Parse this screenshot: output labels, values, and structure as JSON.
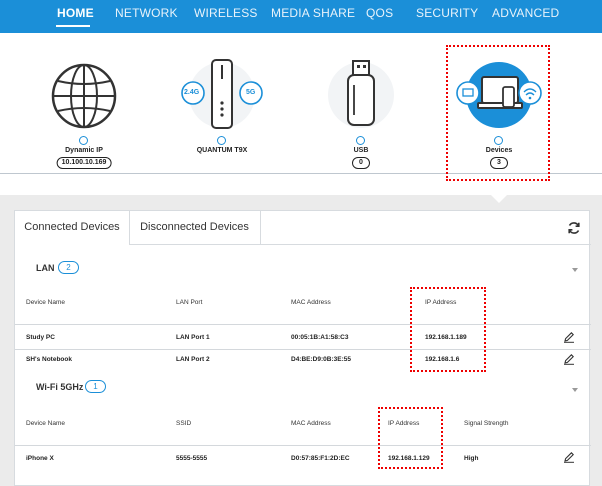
{
  "nav": {
    "items": [
      "HOME",
      "NETWORK",
      "WIRELESS",
      "MEDIA SHARE",
      "QOS",
      "SECURITY",
      "ADVANCED"
    ]
  },
  "topology": {
    "internet": {
      "label": "Dynamic IP",
      "value": "10.100.10.169"
    },
    "router": {
      "label": "QUANTUM T9X",
      "band_a": "2.4G",
      "band_b": "5G"
    },
    "usb": {
      "label": "USB",
      "value": "0"
    },
    "devices": {
      "label": "Devices",
      "value": "3"
    }
  },
  "tabs": {
    "connected": "Connected Devices",
    "disconnected": "Disconnected Devices"
  },
  "lan": {
    "title": "LAN",
    "count": "2",
    "headers": [
      "Device Name",
      "LAN Port",
      "MAC Address",
      "IP Address"
    ],
    "rows": [
      {
        "name": "Study PC",
        "port": "LAN Port 1",
        "mac": "00:05:1B:A1:58:C3",
        "ip": "192.168.1.189"
      },
      {
        "name": "SH's Notebook",
        "port": "LAN Port 2",
        "mac": "D4:BE:D9:0B:3E:55",
        "ip": "192.168.1.6"
      }
    ]
  },
  "wifi": {
    "title": "Wi-Fi 5GHz",
    "count": "1",
    "headers": [
      "Device Name",
      "SSID",
      "MAC Address",
      "IP Address",
      "Signal Strength"
    ],
    "rows": [
      {
        "name": "iPhone X",
        "ssid": "5555-5555",
        "mac": "D0:57:85:F1:2D:EC",
        "ip": "192.168.1.129",
        "signal": "High"
      }
    ]
  },
  "colors": {
    "accent": "#1b8fd8",
    "highlight": "#e00000"
  }
}
